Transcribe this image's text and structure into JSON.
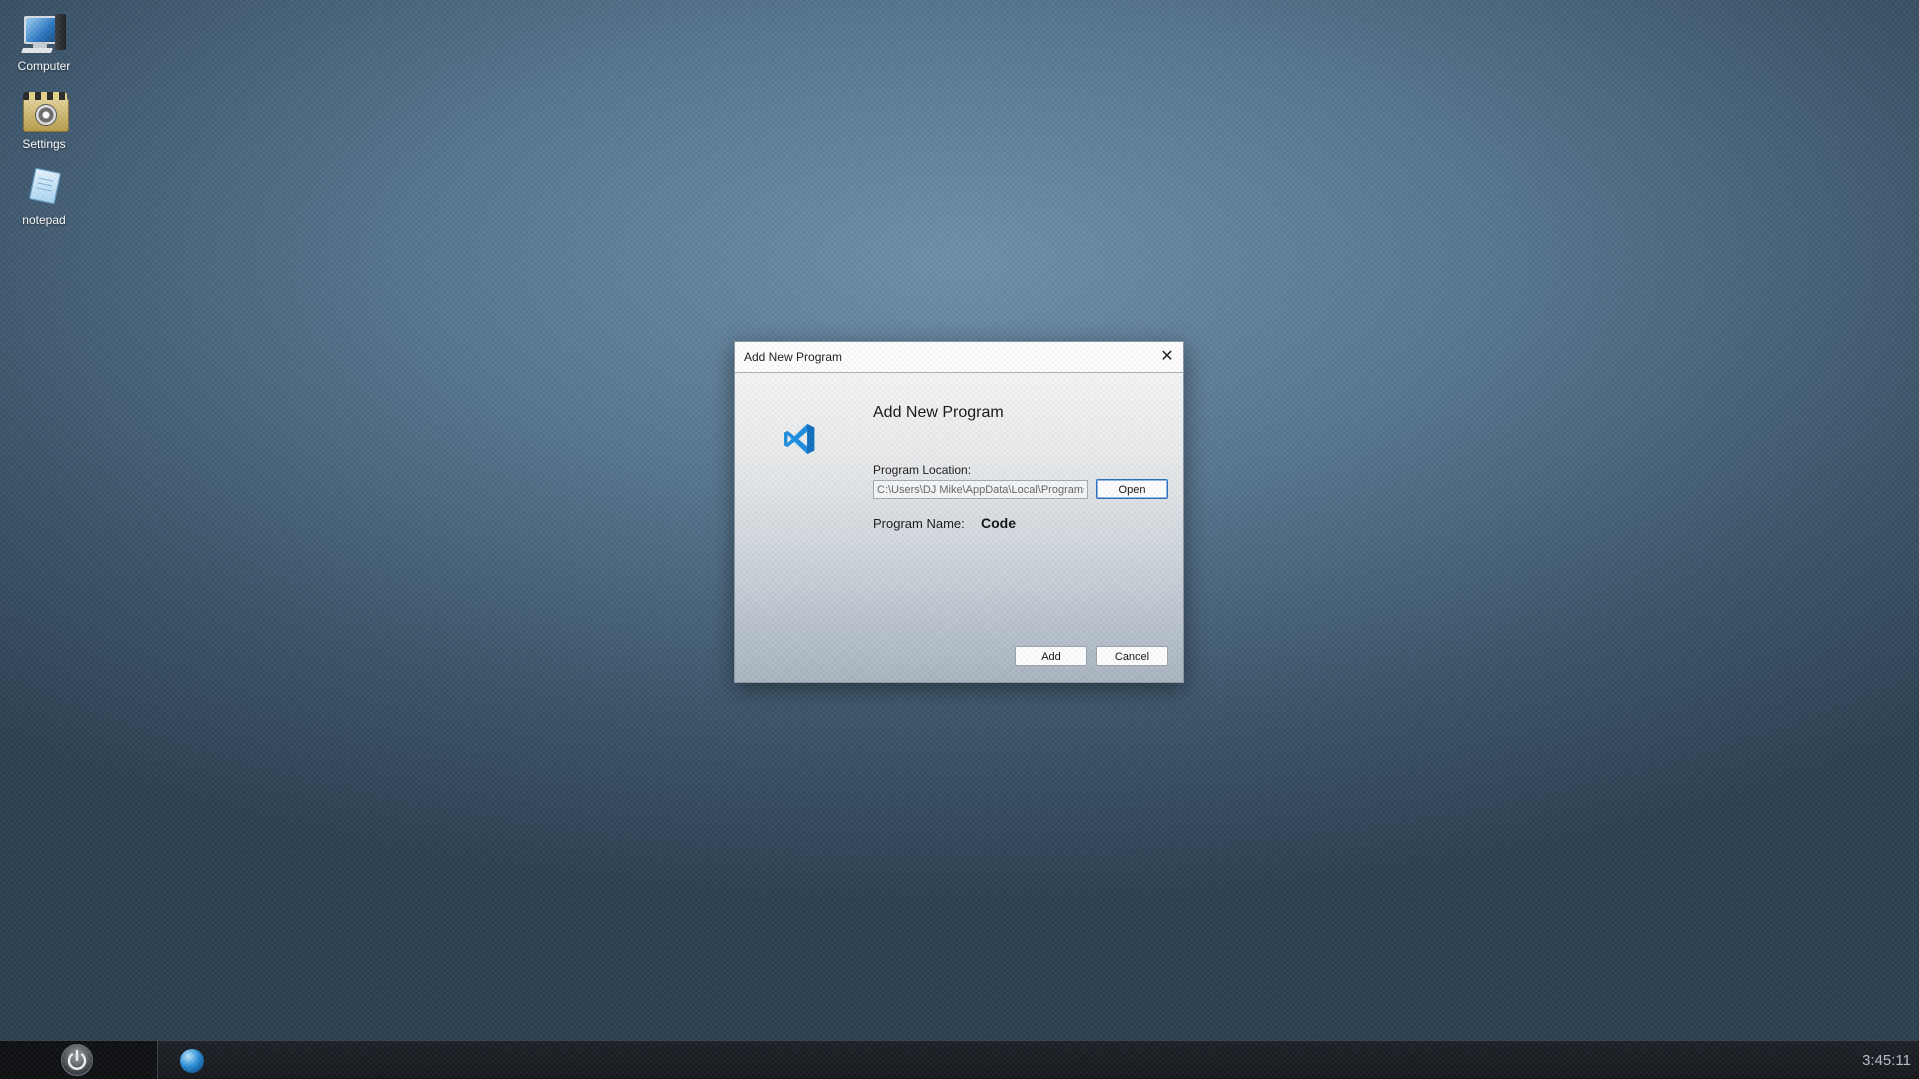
{
  "desktop": {
    "icons": [
      {
        "label": "Computer",
        "icon": "computer-icon"
      },
      {
        "label": "Settings",
        "icon": "settings-icon"
      },
      {
        "label": "notepad",
        "icon": "notepad-icon"
      }
    ]
  },
  "dialog": {
    "window_title": "Add New Program",
    "heading": "Add New Program",
    "close_icon": "close-icon",
    "program_icon": "vscode-icon",
    "location_label": "Program Location:",
    "location_value": "C:\\Users\\DJ Mike\\AppData\\Local\\Programs",
    "open_label": "Open",
    "name_label": "Program Name:",
    "name_value": "Code",
    "add_label": "Add",
    "cancel_label": "Cancel"
  },
  "taskbar": {
    "power_icon": "power-icon",
    "app_icon": "globe-icon",
    "clock": "3:45:11"
  },
  "colors": {
    "accent": "#2b6fbf",
    "vscode_blue": "#1e8fe0"
  }
}
